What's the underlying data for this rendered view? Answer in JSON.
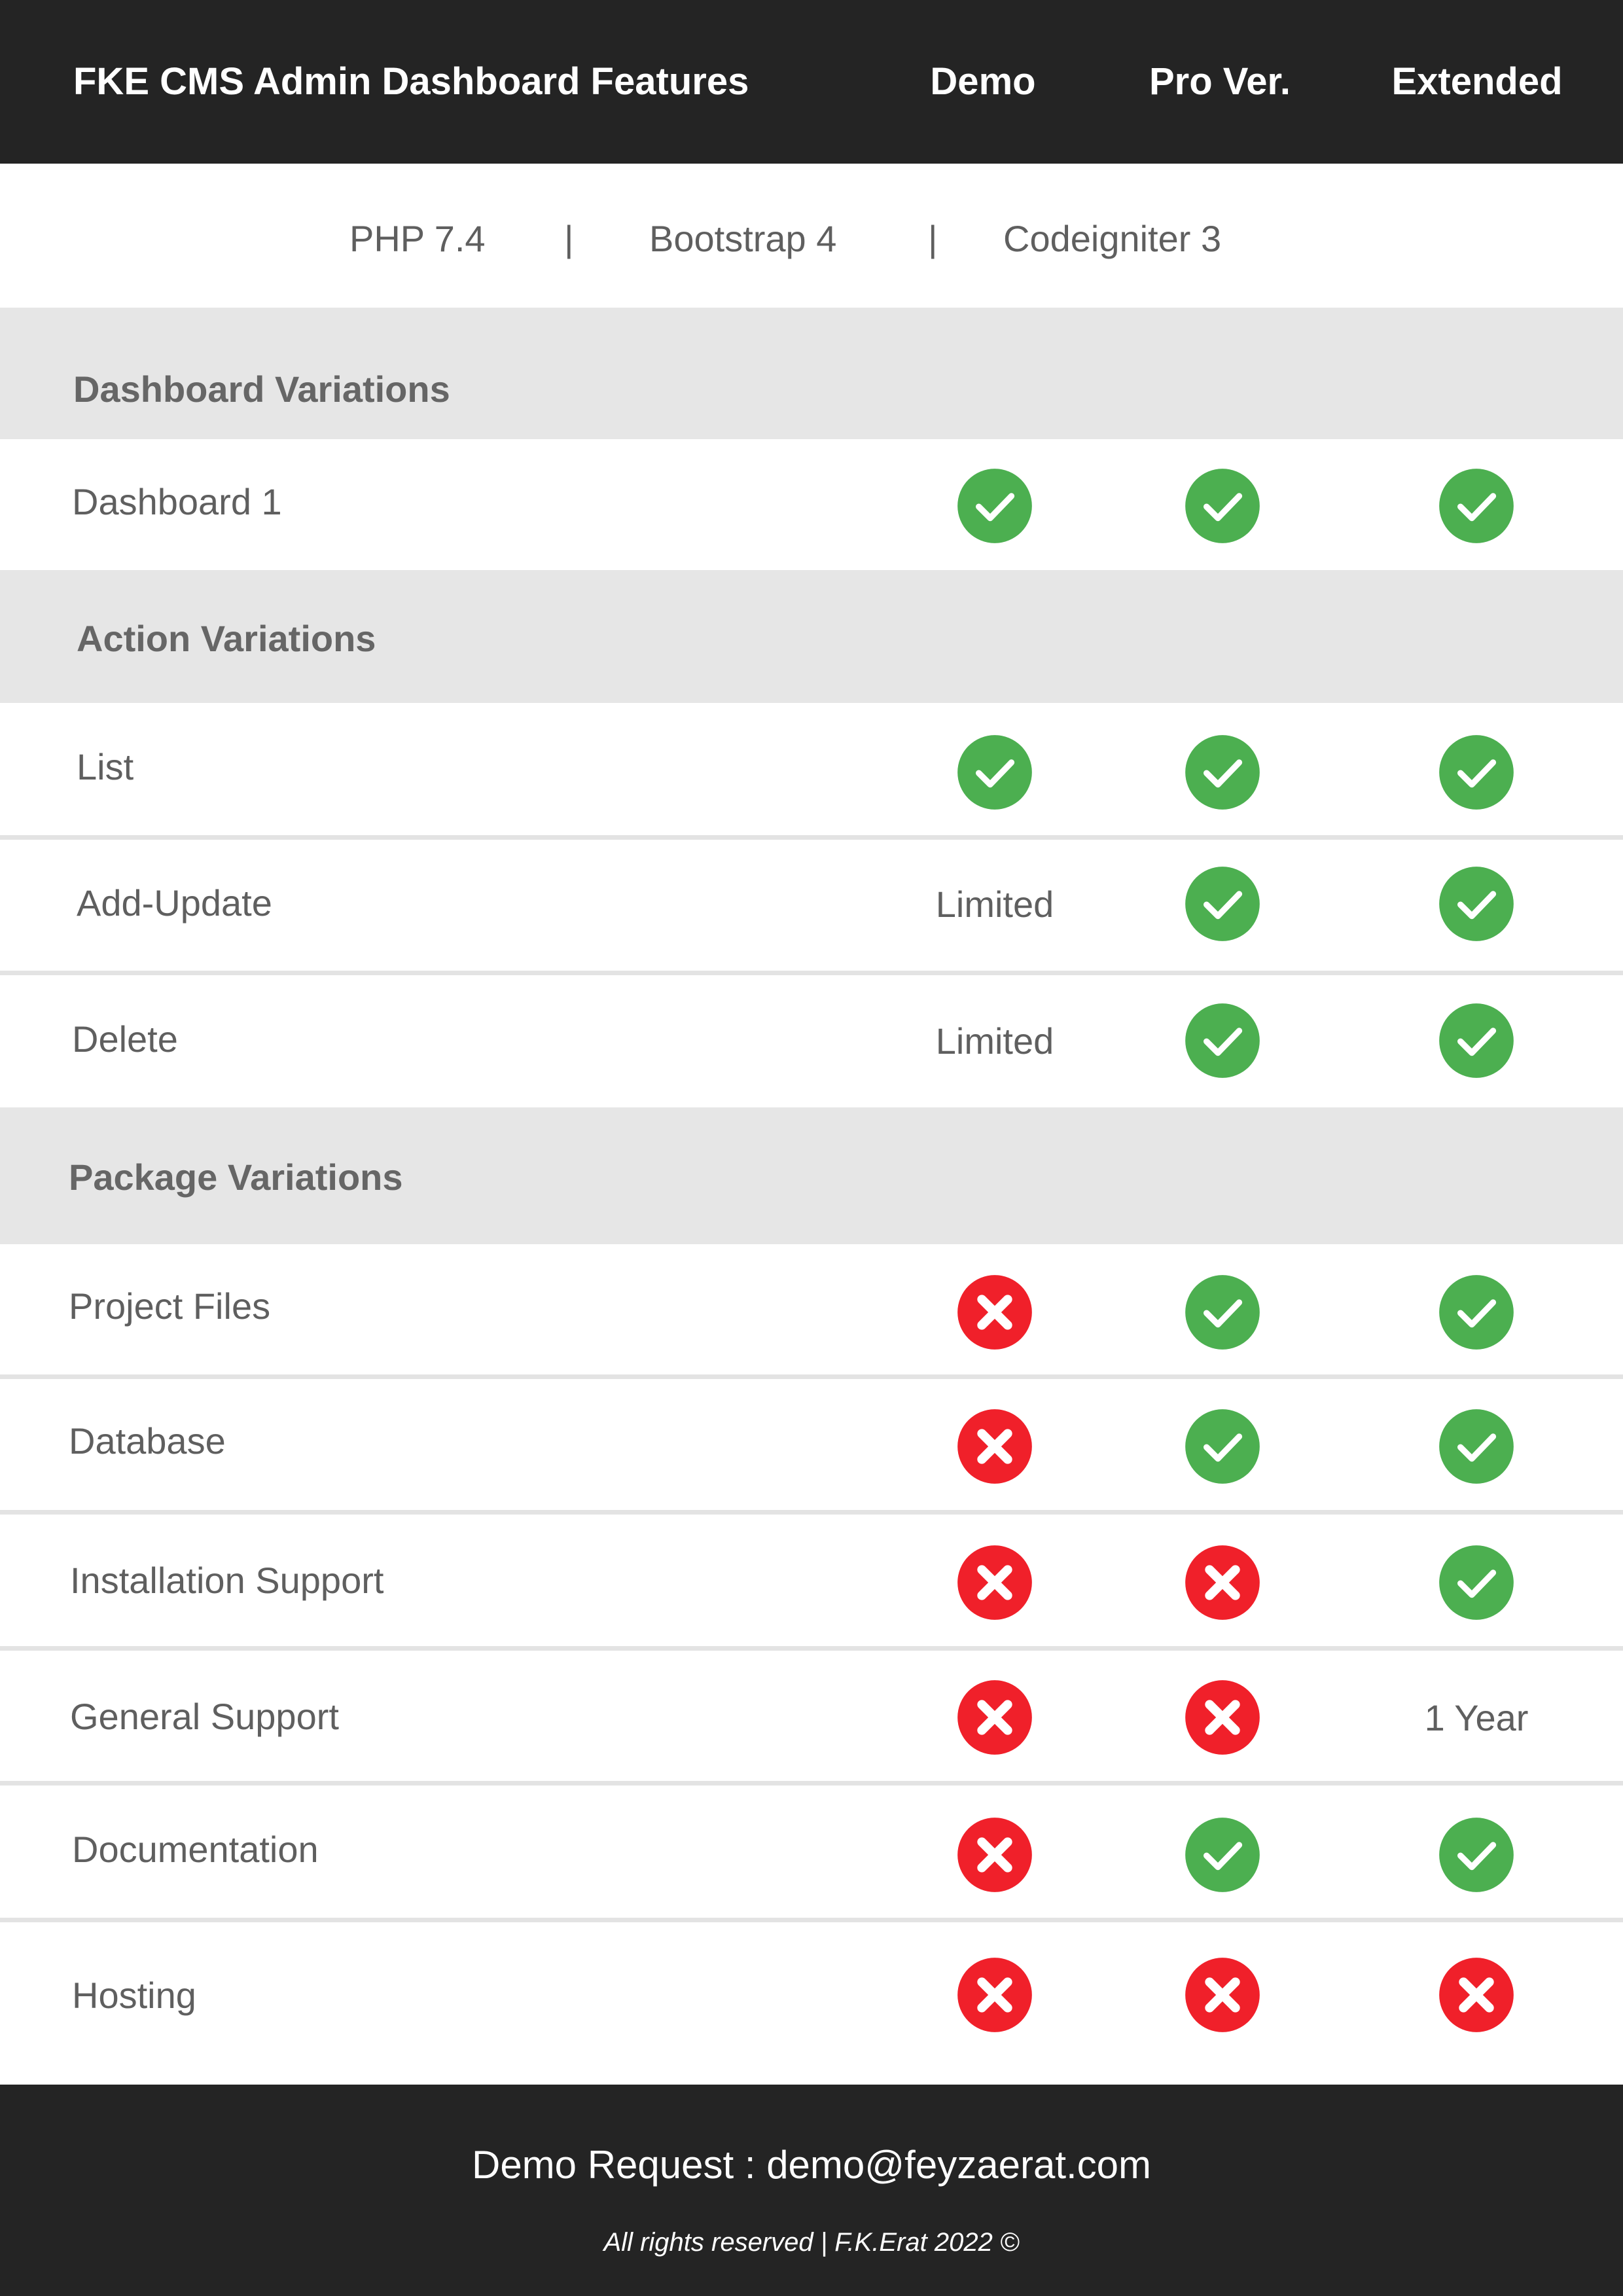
{
  "header": {
    "title": "FKE CMS Admin Dashboard Features",
    "columns": [
      "Demo",
      "Pro Ver.",
      "Extended"
    ]
  },
  "tech": {
    "items": [
      "PHP 7.4",
      "Bootstrap 4",
      "Codeigniter 3"
    ],
    "separator": "|"
  },
  "sections": {
    "dashboard": {
      "title": "Dashboard Variations"
    },
    "action": {
      "title": "Action Variations"
    },
    "package": {
      "title": "Package Variations"
    }
  },
  "rows": {
    "dashboard1": {
      "label": "Dashboard 1",
      "values": [
        "check",
        "check",
        "check"
      ]
    },
    "list": {
      "label": "List",
      "values": [
        "check",
        "check",
        "check"
      ]
    },
    "add_update": {
      "label": "Add-Update",
      "values": [
        "Limited",
        "check",
        "check"
      ]
    },
    "delete": {
      "label": "Delete",
      "values": [
        "Limited",
        "check",
        "check"
      ]
    },
    "project_files": {
      "label": "Project Files",
      "values": [
        "cross",
        "check",
        "check"
      ]
    },
    "database": {
      "label": "Database",
      "values": [
        "cross",
        "check",
        "check"
      ]
    },
    "installation_support": {
      "label": "Installation Support",
      "values": [
        "cross",
        "cross",
        "check"
      ]
    },
    "general_support": {
      "label": "General Support",
      "values": [
        "cross",
        "cross",
        "1 Year"
      ]
    },
    "documentation": {
      "label": "Documentation",
      "values": [
        "cross",
        "check",
        "check"
      ]
    },
    "hosting": {
      "label": "Hosting",
      "values": [
        "cross",
        "cross",
        "cross"
      ]
    }
  },
  "footer": {
    "demo_request": "Demo Request : demo@feyzaerat.com",
    "rights": "All rights reserved | F.K.Erat 2022 ©"
  },
  "colors": {
    "header_bg": "#242424",
    "section_bg": "#e6e6e6",
    "check": "#4caf50",
    "cross": "#f0202a",
    "text": "#5f5f5f"
  },
  "icons": {
    "check": "check-circle-icon",
    "cross": "x-circle-icon"
  }
}
